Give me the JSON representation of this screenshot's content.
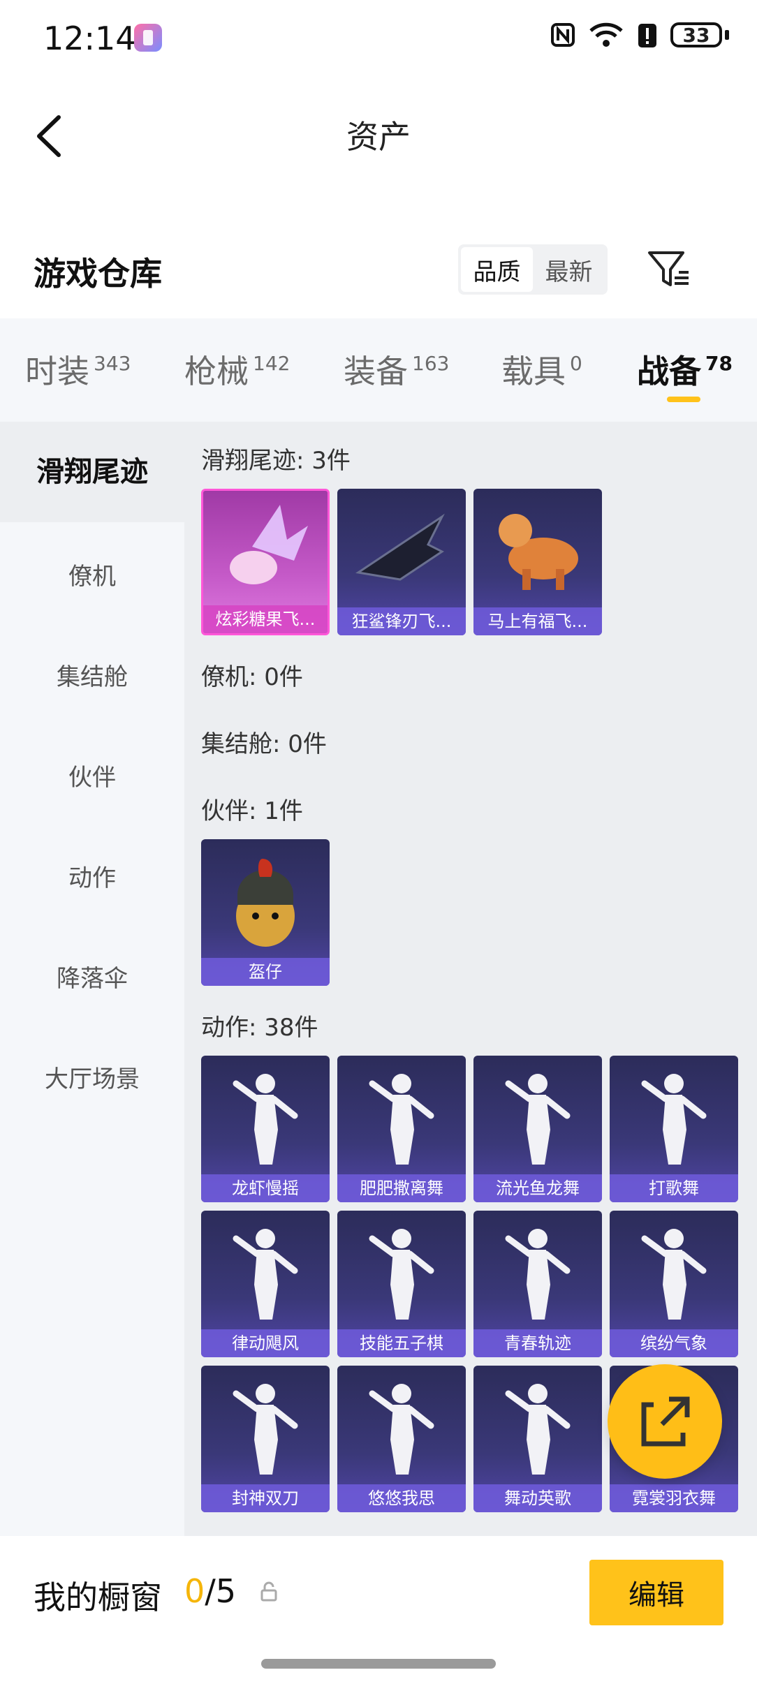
{
  "status_bar": {
    "time": "12:14",
    "battery": "33"
  },
  "header": {
    "title": "资产"
  },
  "warehouse": {
    "title": "游戏仓库",
    "sort_options": [
      "品质",
      "最新"
    ]
  },
  "tabs": [
    {
      "label": "时装",
      "count": "343"
    },
    {
      "label": "枪械",
      "count": "142"
    },
    {
      "label": "装备",
      "count": "163"
    },
    {
      "label": "载具",
      "count": "0"
    },
    {
      "label": "战备",
      "count": "78"
    }
  ],
  "sidebar": {
    "items": [
      "滑翔尾迹",
      "僚机",
      "集结舱",
      "伙伴",
      "动作",
      "降落伞",
      "大厅场景"
    ]
  },
  "sections": {
    "glide": {
      "title": "滑翔尾迹: 3件",
      "items": [
        "炫彩糖果飞...",
        "狂鲨锋刃飞...",
        "马上有福飞..."
      ]
    },
    "wingman": {
      "title": "僚机: 0件"
    },
    "pod": {
      "title": "集结舱: 0件"
    },
    "partner": {
      "title": "伙伴: 1件",
      "items": [
        "盔仔"
      ]
    },
    "emote": {
      "title": "动作: 38件",
      "items": [
        "龙虾慢摇",
        "肥肥撒离舞",
        "流光鱼龙舞",
        "打歌舞",
        "律动飓风",
        "技能五子棋",
        "青春轨迹",
        "缤纷气象",
        "封神双刀",
        "悠悠我思",
        "舞动英歌",
        "霓裳羽衣舞"
      ]
    }
  },
  "bottom_bar": {
    "title": "我的橱窗",
    "count_current": "0",
    "count_total": "/5",
    "edit_label": "编辑"
  },
  "colors": {
    "accent": "#ffc21a",
    "card": "#3a3878",
    "card_label": "#7a5ce0"
  }
}
